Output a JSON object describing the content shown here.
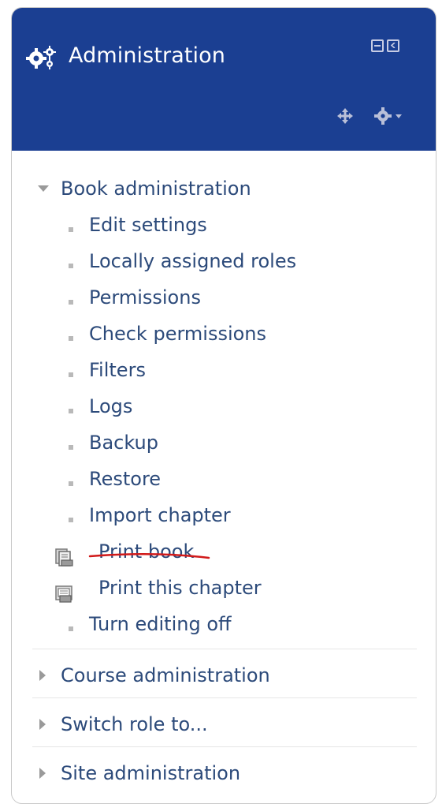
{
  "header": {
    "title": "Administration",
    "icons": [
      "gears-icon",
      "collapse-icon",
      "dock-icon",
      "move-icon",
      "gear-menu-icon"
    ]
  },
  "tree": {
    "book_admin": {
      "label": "Book administration",
      "items": [
        "Edit settings",
        "Locally assigned roles",
        "Permissions",
        "Check permissions",
        "Filters",
        "Logs",
        "Backup",
        "Restore",
        "Import chapter"
      ],
      "print_book": "Print book",
      "print_chapter": "Print this chapter",
      "turn_editing_off": "Turn editing off"
    },
    "course_admin": "Course administration",
    "switch_role": "Switch role to...",
    "site_admin": "Site administration"
  },
  "colors": {
    "header_bg": "#1b3f92",
    "link": "#2c4a7a",
    "annotation_underline": "#d11a1a"
  }
}
